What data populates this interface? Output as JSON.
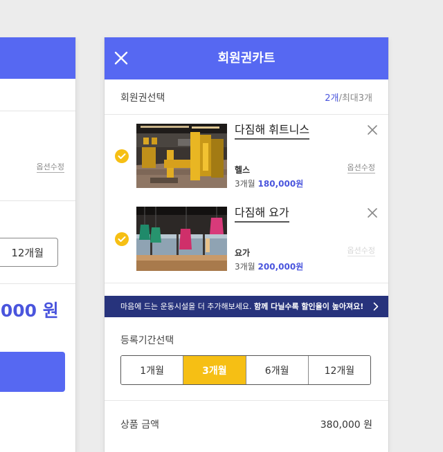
{
  "background_card": {
    "option_edit_label": "옵션수정",
    "selected_period": "12개월",
    "price_partial": "0,000 원"
  },
  "header": {
    "title": "회원권카트",
    "close_icon": "close-icon"
  },
  "selection": {
    "title": "회원권선택",
    "count": "2개",
    "max": "/최대3개"
  },
  "items": [
    {
      "name": "다짐해 휘트니스",
      "type": "헬스",
      "duration": "3개월",
      "price": "180,000원",
      "edit_label": "옵션수정",
      "checked": true
    },
    {
      "name": "다짐해 요가",
      "type": "요가",
      "duration": "3개월",
      "price": "200,000원",
      "edit_label": "옵션수정",
      "checked": true
    }
  ],
  "banner": {
    "text": "마음에 드는 운동시설을 더 추가해보세요.",
    "strong": "함께 다닐수록 할인율이 높아져요!"
  },
  "period": {
    "title": "등록기간선택",
    "options": [
      "1개월",
      "3개월",
      "6개월",
      "12개월"
    ],
    "selected": "3개월"
  },
  "total": {
    "label": "상품 금액",
    "value": "380,000 원"
  },
  "colors": {
    "primary": "#5668f2",
    "accent_yellow": "#f6bf14",
    "banner_navy": "#27337c",
    "price_blue": "#4a55dd"
  }
}
